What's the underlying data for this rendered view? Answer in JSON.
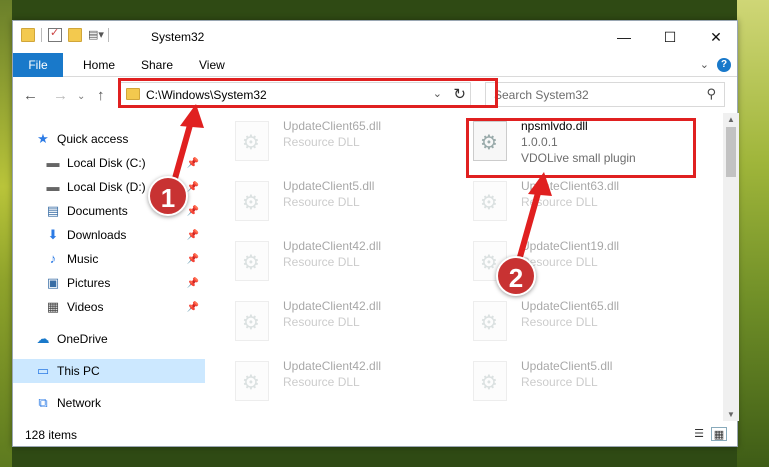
{
  "window": {
    "title": "System32",
    "controls": {
      "minimize": "—",
      "maximize": "☐",
      "close": "✕"
    }
  },
  "ribbon": {
    "tabs": [
      "File",
      "Home",
      "Share",
      "View"
    ],
    "help": "?"
  },
  "nav": {
    "back": "←",
    "forward": "→",
    "up": "↑",
    "address": "C:\\Windows\\System32",
    "search_placeholder": "Search System32"
  },
  "sidebar": {
    "items": [
      {
        "label": "Quick access",
        "icon": "star-icon",
        "glyph": "★",
        "color": "#2c7be5",
        "pinned": false
      },
      {
        "label": "Local Disk (C:)",
        "icon": "drive-icon",
        "glyph": "▬",
        "color": "#666666",
        "pinned": true
      },
      {
        "label": "Local Disk (D:)",
        "icon": "drive-icon",
        "glyph": "▬",
        "color": "#666666",
        "pinned": true
      },
      {
        "label": "Documents",
        "icon": "documents-icon",
        "glyph": "▤",
        "color": "#3a6ea5",
        "pinned": true
      },
      {
        "label": "Downloads",
        "icon": "downloads-icon",
        "glyph": "⬇",
        "color": "#2c7be5",
        "pinned": true
      },
      {
        "label": "Music",
        "icon": "music-icon",
        "glyph": "♪",
        "color": "#2c7be5",
        "pinned": true
      },
      {
        "label": "Pictures",
        "icon": "pictures-icon",
        "glyph": "▣",
        "color": "#3a6ea5",
        "pinned": true
      },
      {
        "label": "Videos",
        "icon": "videos-icon",
        "glyph": "▦",
        "color": "#444444",
        "pinned": true
      },
      {
        "label": "OneDrive",
        "icon": "cloud-icon",
        "glyph": "☁",
        "color": "#1979ca",
        "pinned": false
      },
      {
        "label": "This PC",
        "icon": "computer-icon",
        "glyph": "▭",
        "color": "#2c7be5",
        "pinned": false
      },
      {
        "label": "Network",
        "icon": "network-icon",
        "glyph": "⧉",
        "color": "#2c7be5",
        "pinned": false
      }
    ]
  },
  "files": [
    {
      "name": "UpdateClient65.dll",
      "type": "Resource DLL"
    },
    {
      "name": "UpdateClient5.dll",
      "type": "Resource DLL"
    },
    {
      "name": "UpdateClient42.dll",
      "type": "Resource DLL"
    },
    {
      "name": "UpdateClient42.dll",
      "type": "Resource DLL"
    },
    {
      "name": "UpdateClient42.dll",
      "type": "Resource DLL"
    },
    {
      "name": "UpdateClient",
      "type": ""
    },
    {
      "name": "npsmlvdo.dll",
      "version": "1.0.0.1",
      "description": "VDOLive small plugin"
    },
    {
      "name": "UpdateClient63.dll",
      "type": "Resource DLL"
    },
    {
      "name": "UpdateClient19.dll",
      "type": "Resource DLL"
    },
    {
      "name": "UpdateClient65.dll",
      "type": "Resource DLL"
    },
    {
      "name": "UpdateClient5.dll",
      "type": "Resource DLL"
    },
    {
      "name": "UpdateClient",
      "type": ""
    }
  ],
  "status": {
    "item_count": "128 items"
  },
  "annotations": {
    "step1": "1",
    "step2": "2",
    "highlight_color": "#e02020"
  }
}
